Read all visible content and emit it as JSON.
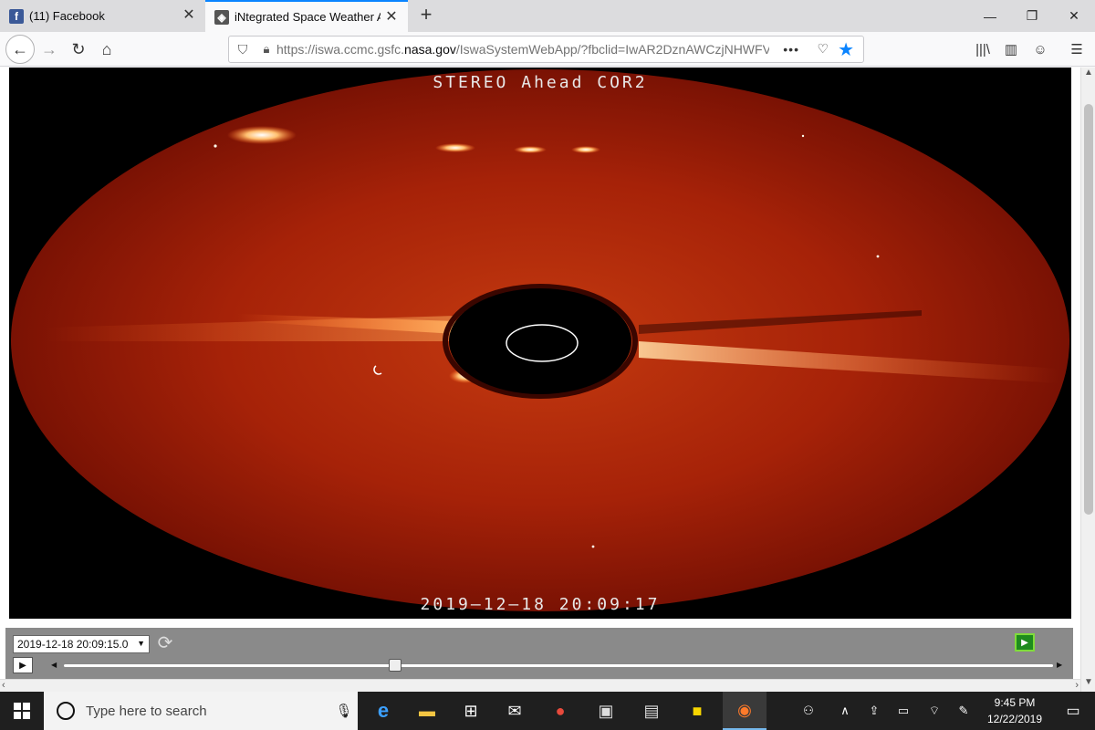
{
  "tabs": [
    {
      "title": "(11) Facebook",
      "favicon": "f"
    },
    {
      "title": "iNtegrated Space Weather Analysis",
      "favicon": "iswa-icon"
    }
  ],
  "url": {
    "prefix": "https://iswa.ccmc.gsfc.",
    "domain": "nasa.gov",
    "suffix": "/IswaSystemWebApp/?fbclid=IwAR2DznAWCzjNHWFV"
  },
  "image": {
    "title": "STEREO Ahead COR2",
    "timestamp": "2019—12—18  20:09:17"
  },
  "controls": {
    "date_value": "2019-12-18 20:09:15.0",
    "slider_position": 0.335
  },
  "taskbar": {
    "search_placeholder": "Type here to search",
    "time": "9:45 PM",
    "date": "12/22/2019"
  },
  "colors": {
    "accent": "#0a84ff",
    "corona": "#b0240a",
    "taskbar": "#1f1f1f"
  }
}
